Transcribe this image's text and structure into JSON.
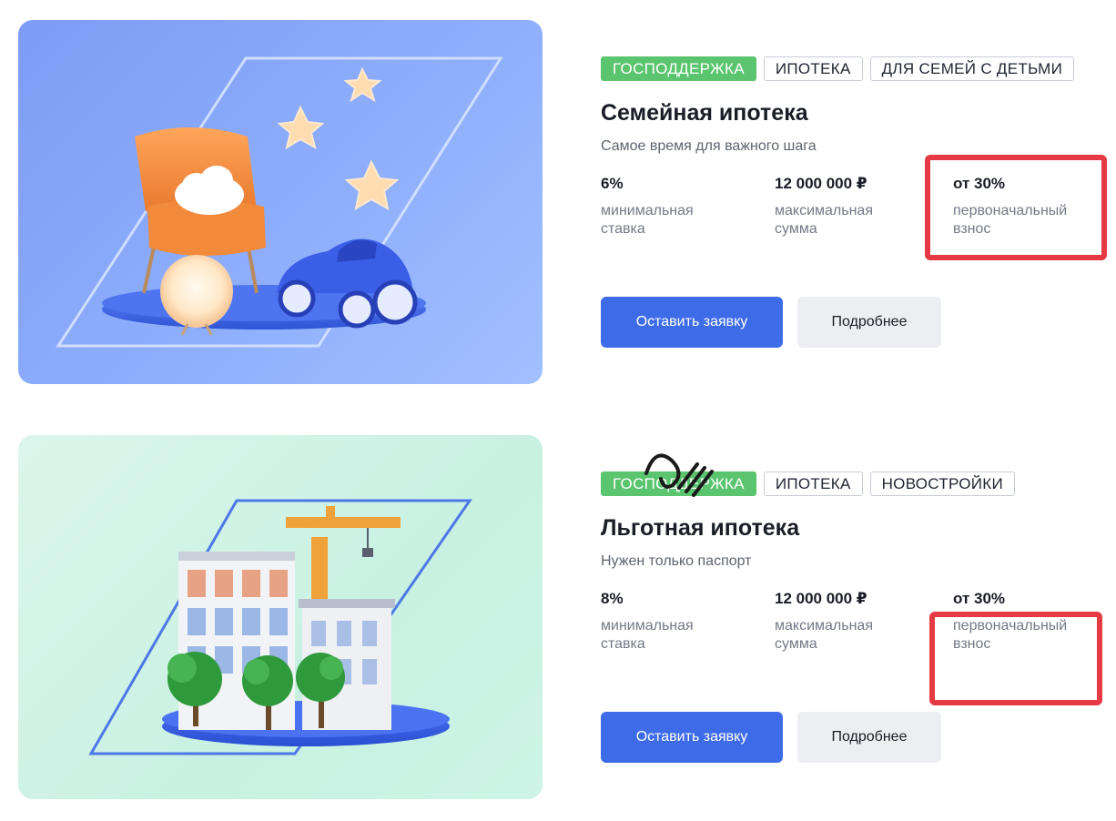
{
  "products": [
    {
      "tags": [
        "ГОСПОДДЕРЖКА",
        "ИПОТЕКА",
        "ДЛЯ СЕМЕЙ С ДЕТЬМИ"
      ],
      "title": "Семейная ипотека",
      "subtitle": "Самое время для важного шага",
      "stats": [
        {
          "value": "6%",
          "label": "минимальная ставка"
        },
        {
          "value": "12 000 000 ₽",
          "label": "максимальная сумма"
        },
        {
          "value": "от 30%",
          "label": "первоначальный взнос"
        }
      ],
      "apply_label": "Оставить заявку",
      "more_label": "Подробнее"
    },
    {
      "tags": [
        "ГОСПОДДЕРЖКА",
        "ИПОТЕКА",
        "НОВОСТРОЙКИ"
      ],
      "title": "Льготная ипотека",
      "subtitle": "Нужен только паспорт",
      "stats": [
        {
          "value": "8%",
          "label": "минимальная ставка"
        },
        {
          "value": "12 000 000 ₽",
          "label": "максимальная сумма"
        },
        {
          "value": "от 30%",
          "label": "первоначальный взнос"
        }
      ],
      "apply_label": "Оставить заявку",
      "more_label": "Подробнее"
    }
  ],
  "colors": {
    "accent_button": "#3e6be8",
    "tag_green": "#5ac46e",
    "highlight_red": "#e53a44"
  }
}
